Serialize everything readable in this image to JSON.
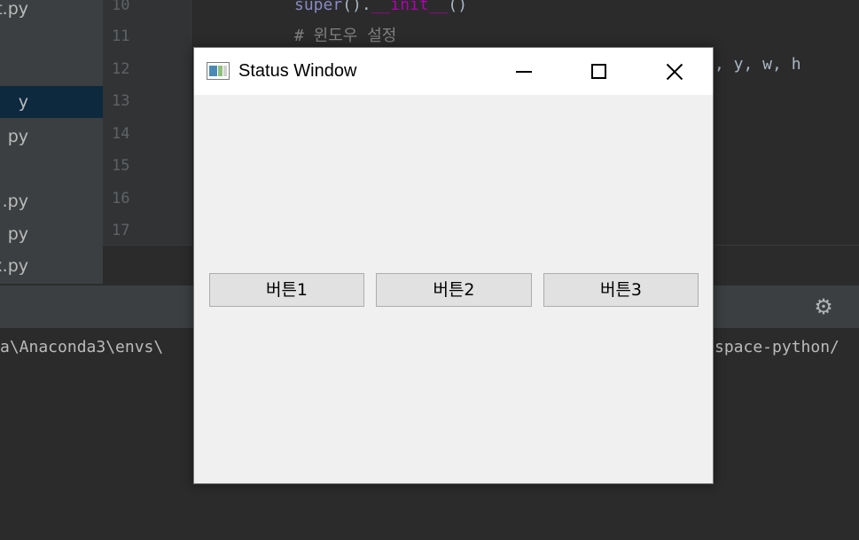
{
  "ide": {
    "files": [
      "t.py",
      "",
      "",
      "y",
      "py",
      "",
      ".py",
      "py",
      "x.py"
    ],
    "line_numbers": [
      "10",
      "11",
      "12",
      "13",
      "14",
      "15",
      "16",
      "17"
    ],
    "code": {
      "line10_super": "super",
      "line10_paren": "().",
      "line10_dunder": "__init__",
      "line10_end": "()",
      "line11_comment": "# 윈도우 설정",
      "line12_tail": ", y, w, h"
    },
    "console": {
      "left_text": "a\\Anaconda3\\envs\\",
      "right_text": "space-python/"
    },
    "gear_icon": "gear-icon"
  },
  "window": {
    "title": "Status Window",
    "icon": "app-window-icon",
    "buttons": [
      {
        "label": "버튼1"
      },
      {
        "label": "버튼2"
      },
      {
        "label": "버튼3"
      }
    ],
    "colors": {
      "client_bg": "#f0f0f0",
      "button_bg": "#e1e1e1",
      "titlebar_bg": "#ffffff"
    }
  }
}
